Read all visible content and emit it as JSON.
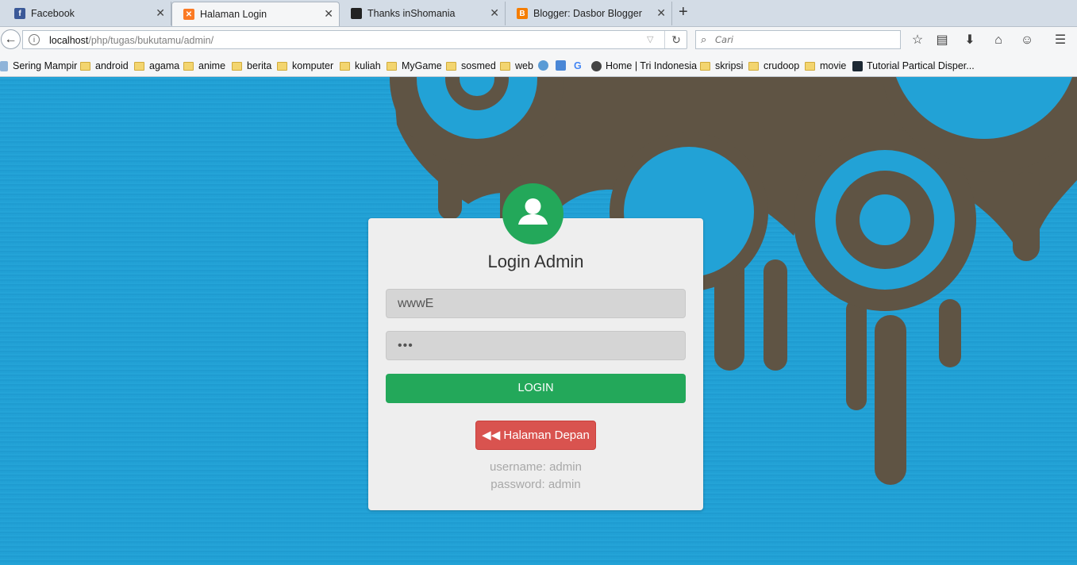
{
  "browser": {
    "tabs": [
      {
        "title": "Facebook",
        "favicon": "facebook-icon",
        "color": "#3b5998"
      },
      {
        "title": "Halaman Login",
        "favicon": "xampp-icon",
        "color": "#fb7a24",
        "active": true
      },
      {
        "title": "Thanks inShomania",
        "favicon": "thumbnail-icon",
        "color": "#222222"
      },
      {
        "title": "Blogger: Dasbor Blogger",
        "favicon": "blogger-icon",
        "color": "#f57d00"
      }
    ],
    "url": {
      "host": "localhost",
      "path": "/php/tugas/bukutamu/admin/"
    },
    "search_placeholder": "Cari",
    "bookmarks": [
      {
        "label": "Sering Mampir",
        "icon": "bookmark-icon"
      },
      {
        "label": "android",
        "icon": "folder-icon"
      },
      {
        "label": "agama",
        "icon": "folder-icon"
      },
      {
        "label": "anime",
        "icon": "folder-icon"
      },
      {
        "label": "berita",
        "icon": "folder-icon"
      },
      {
        "label": "komputer",
        "icon": "folder-icon"
      },
      {
        "label": "kuliah",
        "icon": "folder-icon"
      },
      {
        "label": "MyGame",
        "icon": "folder-icon"
      },
      {
        "label": "sosmed",
        "icon": "folder-icon"
      },
      {
        "label": "web",
        "icon": "folder-icon"
      },
      {
        "label": "Home | Tri Indonesia",
        "icon": "tri-icon"
      },
      {
        "label": "skripsi",
        "icon": "folder-icon"
      },
      {
        "label": "crudoop",
        "icon": "folder-icon"
      },
      {
        "label": "movie",
        "icon": "folder-icon"
      },
      {
        "label": "Tutorial Partical Disper...",
        "icon": "page-icon"
      }
    ]
  },
  "login": {
    "title": "Login Admin",
    "username_value": "wwwE",
    "password_value": "•••",
    "login_label": "LOGIN",
    "back_label": "Halaman Depan",
    "hint_username": "username: admin",
    "hint_password": "password: admin"
  },
  "colors": {
    "background": "#22a2d6",
    "decoration": "#5f5444",
    "success": "#23a85a",
    "danger": "#d9534f",
    "card": "#eeeeee"
  }
}
